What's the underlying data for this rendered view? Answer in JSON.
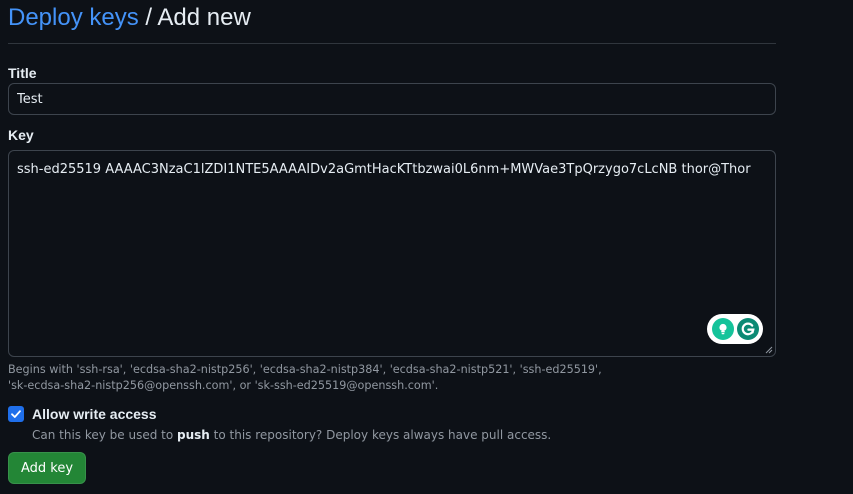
{
  "header": {
    "breadcrumb_link": "Deploy keys",
    "separator": "/",
    "title": "Add new"
  },
  "form": {
    "title_label": "Title",
    "title_value": "Test",
    "key_label": "Key",
    "key_value": "ssh-ed25519 AAAAC3NzaC1lZDI1NTE5AAAAIDv2aGmtHacKTtbzwai0L6nm+MWVae3TpQrzygo7cLcNB thor@Thor",
    "key_hint_line1": "Begins with 'ssh-rsa', 'ecdsa-sha2-nistp256', 'ecdsa-sha2-nistp384', 'ecdsa-sha2-nistp521', 'ssh-ed25519',",
    "key_hint_line2": "'sk-ecdsa-sha2-nistp256@openssh.com', or 'sk-ssh-ed25519@openssh.com'.",
    "write_access_label": "Allow write access",
    "write_access_checked": true,
    "write_access_desc_pre": "Can this key be used to ",
    "write_access_desc_bold": "push",
    "write_access_desc_post": " to this repository? Deploy keys always have pull access.",
    "submit_label": "Add key"
  },
  "icons": {
    "grammarly_suggest": "lightbulb-icon",
    "grammarly_logo": "grammarly-g-icon",
    "checkbox": "checkmark-icon"
  },
  "colors": {
    "background": "#0d1117",
    "link": "#4493f8",
    "accent_green": "#238636",
    "checkbox_blue": "#1f6feb",
    "grammarly_green": "#15c39a",
    "grammarly_teal": "#0c8a74"
  }
}
